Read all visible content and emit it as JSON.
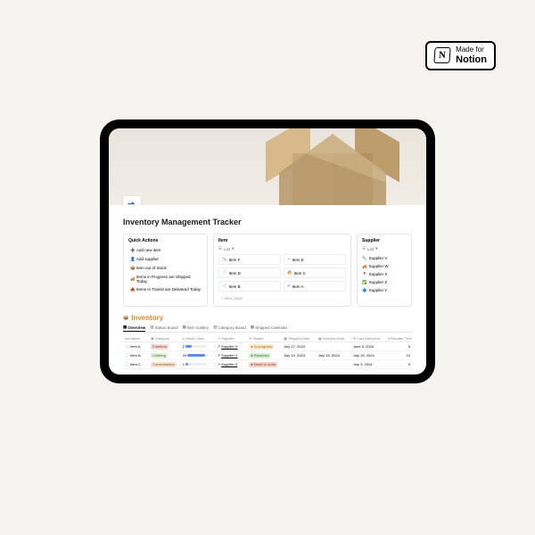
{
  "badge": {
    "top": "Made for",
    "bottom": "Notion",
    "logo_letter": "N"
  },
  "page": {
    "title": "Inventory Management Tracker",
    "quick_actions": {
      "heading": "Quick Actions",
      "items": [
        {
          "icon": "➕",
          "label": "Add new item"
        },
        {
          "icon": "👤",
          "label": "Add supplier"
        },
        {
          "icon": "📦",
          "label": "Item out of Stock"
        },
        {
          "icon": "🚚",
          "label": "Items in Progress are Shipped Today"
        },
        {
          "icon": "📥",
          "label": "Items In Transit are Delivered Today"
        }
      ]
    },
    "item_panel": {
      "heading": "Item",
      "view": "List",
      "items": [
        "Item F",
        "Item E",
        "Item D",
        "Item C",
        "Item B",
        "Item A"
      ],
      "new_page": "+ New page"
    },
    "supplier_panel": {
      "heading": "Supplier",
      "view": "List",
      "items": [
        "Supplier V",
        "Supplier W",
        "Supplier X",
        "Supplier Z",
        "Supplier Y"
      ]
    },
    "inventory": {
      "heading": "Inventory",
      "tabs": [
        "Overview",
        "Status Board",
        "Item Gallery",
        "Category Board",
        "Shipped Calendar"
      ],
      "columns": [
        "Aa Name",
        "Category",
        "# Stock Level",
        "Supplier",
        "Status",
        "Shipped Date",
        "Delivery Date",
        "Last Delivered",
        "# Reorder Threshold"
      ],
      "rows": [
        {
          "name": "Item A",
          "category": "Furniture",
          "cat_class": "tag-furn",
          "stock": "2",
          "bar": "b2",
          "supplier": "Supplier X",
          "status": "In progress",
          "st_class": "st-prog",
          "shipped": "July 27, 2024",
          "delivery": "",
          "last": "June 5, 2024",
          "thr": "5"
        },
        {
          "name": "Item B",
          "category": "Clothing",
          "cat_class": "tag-cloth",
          "stock": "20",
          "bar": "b20",
          "supplier": "Supplier Y",
          "status": "Received",
          "st_class": "st-recv",
          "shipped": "July 10, 2024",
          "delivery": "July 15, 2024",
          "last": "July 15, 2024",
          "thr": "10"
        },
        {
          "name": "Item C",
          "category": "Consumables",
          "cat_class": "tag-cons",
          "stock": "1",
          "bar": "b1",
          "supplier": "Supplier Z",
          "status": "Need to order",
          "st_class": "st-need",
          "shipped": "",
          "delivery": "",
          "last": "July 3, 2024",
          "thr": "5"
        }
      ]
    }
  }
}
